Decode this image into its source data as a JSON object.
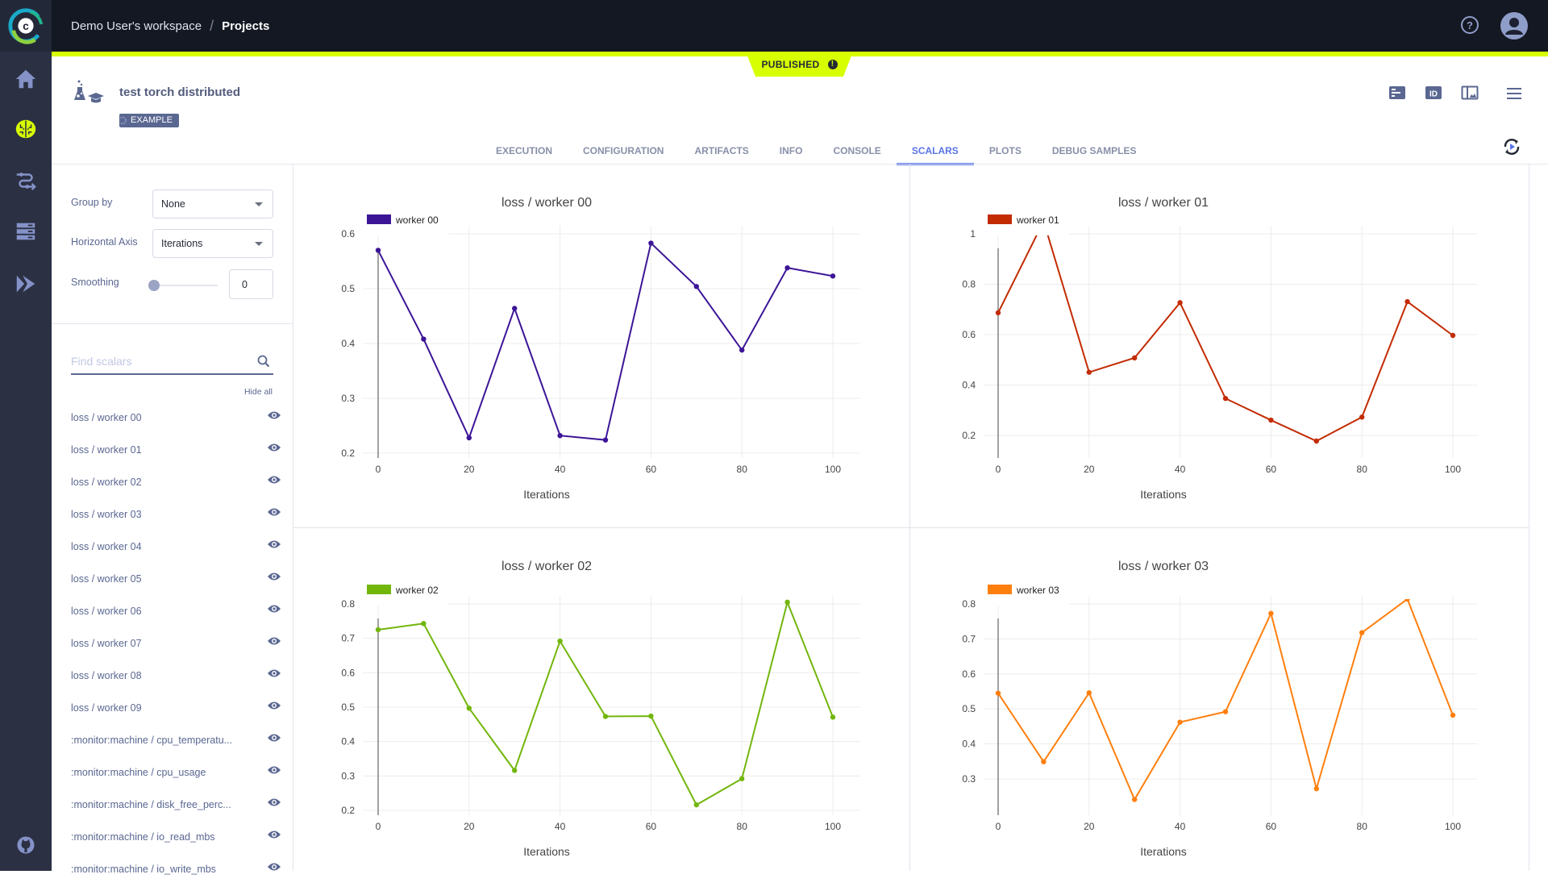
{
  "app": {
    "breadcrumb": {
      "workspace": "Demo User's workspace",
      "separator": "/",
      "current": "Projects"
    },
    "status_badge": "PUBLISHED"
  },
  "nav": {
    "items": [
      {
        "name": "home",
        "icon": "home-icon"
      },
      {
        "name": "experiments",
        "icon": "brain-icon",
        "active": true
      },
      {
        "name": "pipelines",
        "icon": "pipelines-icon"
      },
      {
        "name": "datasets",
        "icon": "datasets-icon"
      },
      {
        "name": "orchestration",
        "icon": "chevrons-icon"
      }
    ],
    "footer": {
      "icon": "github-icon"
    }
  },
  "experiment": {
    "title": "test torch distributed",
    "tag": "EXAMPLE",
    "header_icons": [
      "details-icon",
      "id-icon",
      "panel-layout-icon",
      "menu-icon"
    ]
  },
  "tabs": [
    {
      "label": "EXECUTION"
    },
    {
      "label": "CONFIGURATION"
    },
    {
      "label": "ARTIFACTS"
    },
    {
      "label": "INFO"
    },
    {
      "label": "CONSOLE"
    },
    {
      "label": "SCALARS",
      "active": true
    },
    {
      "label": "PLOTS"
    },
    {
      "label": "DEBUG SAMPLES"
    }
  ],
  "controls": {
    "group_by_label": "Group by",
    "group_by_value": "None",
    "horizontal_axis_label": "Horizontal Axis",
    "horizontal_axis_value": "Iterations",
    "smoothing_label": "Smoothing",
    "smoothing_value": "0",
    "smoothing_fraction": 0,
    "search_placeholder": "Find scalars",
    "hide_all": "Hide all"
  },
  "scalars": [
    "loss / worker 00",
    "loss / worker 01",
    "loss / worker 02",
    "loss / worker 03",
    "loss / worker 04",
    "loss / worker 05",
    "loss / worker 06",
    "loss / worker 07",
    "loss / worker 08",
    "loss / worker 09",
    ":monitor:machine / cpu_temperatu...",
    ":monitor:machine / cpu_usage",
    ":monitor:machine / disk_free_perc...",
    ":monitor:machine / io_read_mbs",
    ":monitor:machine / io_write_mbs"
  ],
  "chart_data": [
    {
      "type": "line",
      "title": "loss / worker 00",
      "xlabel": "Iterations",
      "ylabel": "",
      "legend": "worker 00",
      "legend_position": "top-left",
      "color": "#3c1597",
      "grid": true,
      "x": [
        0,
        10,
        20,
        30,
        40,
        50,
        60,
        70,
        80,
        90,
        100
      ],
      "values": [
        0.57,
        0.408,
        0.228,
        0.464,
        0.232,
        0.224,
        0.583,
        0.504,
        0.388,
        0.538,
        0.523
      ],
      "xlim": [
        0,
        100
      ],
      "ylim": [
        0.2,
        0.6
      ],
      "xticks": [
        0,
        20,
        40,
        60,
        80,
        100
      ],
      "yticks": [
        0.2,
        0.3,
        0.4,
        0.5,
        0.6
      ]
    },
    {
      "type": "line",
      "title": "loss / worker 01",
      "xlabel": "Iterations",
      "ylabel": "",
      "legend": "worker 01",
      "legend_position": "top-left",
      "color": "#c32b03",
      "grid": true,
      "x": [
        0,
        10,
        20,
        30,
        40,
        50,
        60,
        70,
        80,
        90,
        100
      ],
      "values": [
        0.687,
        1.05,
        0.451,
        0.508,
        0.727,
        0.347,
        0.261,
        0.178,
        0.273,
        0.731,
        0.597
      ],
      "xlim": [
        0,
        100
      ],
      "ylim": [
        0.13,
        1.0
      ],
      "xticks": [
        0,
        20,
        40,
        60,
        80,
        100
      ],
      "yticks": [
        0.2,
        0.4,
        0.6,
        0.8,
        1
      ]
    },
    {
      "type": "line",
      "title": "loss / worker 02",
      "xlabel": "Iterations",
      "ylabel": "",
      "legend": "worker 02",
      "legend_position": "top-left",
      "color": "#72b60c",
      "grid": true,
      "x": [
        0,
        10,
        20,
        30,
        40,
        50,
        60,
        70,
        80,
        90,
        100
      ],
      "values": [
        0.725,
        0.743,
        0.497,
        0.316,
        0.692,
        0.473,
        0.474,
        0.216,
        0.292,
        0.805,
        0.471
      ],
      "xlim": [
        0,
        100
      ],
      "ylim": [
        0.2,
        0.8
      ],
      "xticks": [
        0,
        20,
        40,
        60,
        80,
        100
      ],
      "yticks": [
        0.2,
        0.3,
        0.4,
        0.5,
        0.6,
        0.7,
        0.8
      ]
    },
    {
      "type": "line",
      "title": "loss / worker 03",
      "xlabel": "Iterations",
      "ylabel": "",
      "legend": "worker 03",
      "legend_position": "top-left",
      "color": "#ff7f0e",
      "grid": true,
      "x": [
        0,
        10,
        20,
        30,
        40,
        50,
        60,
        70,
        80,
        90,
        100
      ],
      "values": [
        0.545,
        0.349,
        0.546,
        0.241,
        0.462,
        0.492,
        0.773,
        0.272,
        0.718,
        0.814,
        0.482
      ],
      "xlim": [
        0,
        100
      ],
      "ylim": [
        0.21,
        0.8
      ],
      "xticks": [
        0,
        20,
        40,
        60,
        80,
        100
      ],
      "yticks": [
        0.3,
        0.4,
        0.5,
        0.6,
        0.7,
        0.8
      ]
    }
  ]
}
